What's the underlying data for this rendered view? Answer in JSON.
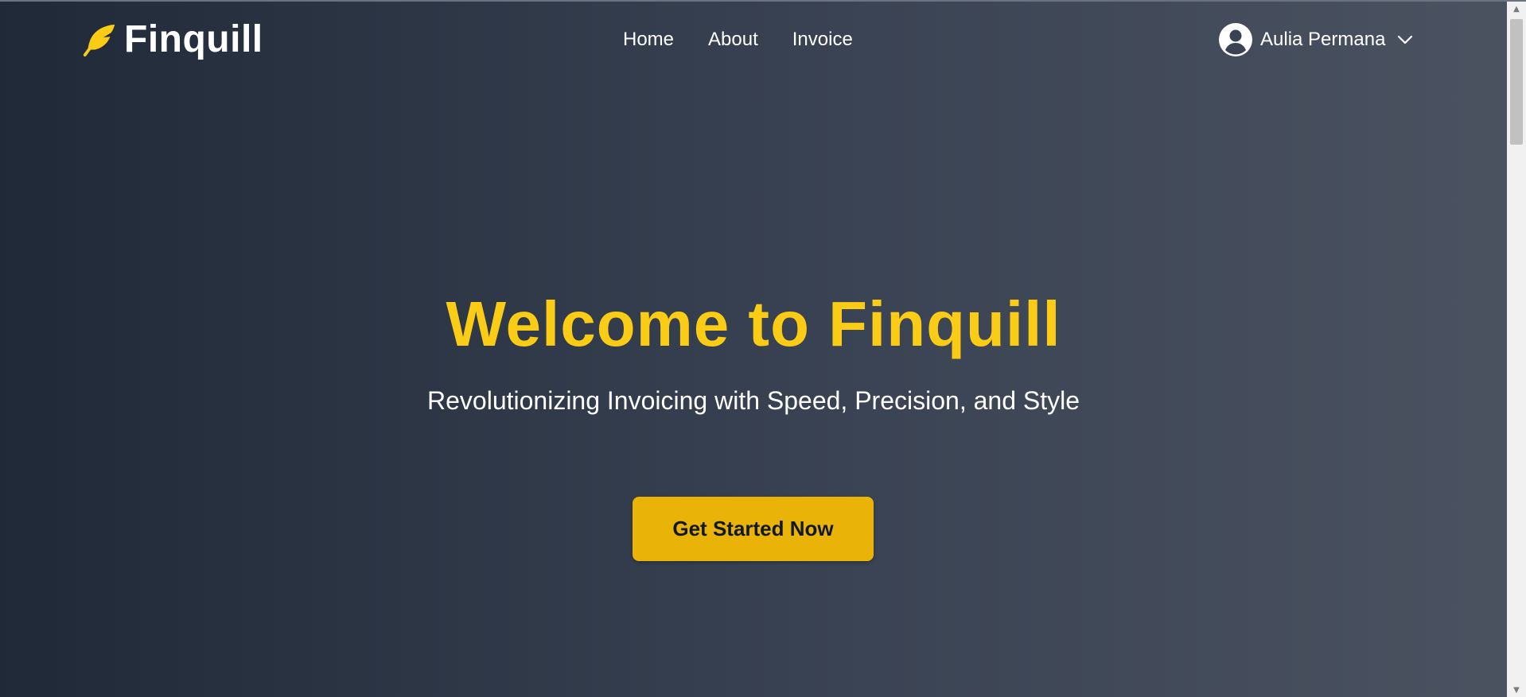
{
  "nav": {
    "brand": "Finquill",
    "links": [
      "Home",
      "About",
      "Invoice"
    ],
    "user_name": "Aulia Permana"
  },
  "hero": {
    "title": "Welcome to Finquill",
    "subtitle": "Revolutionizing Invoicing with Speed, Precision, and Style",
    "cta_label": "Get Started Now"
  },
  "icons": {
    "brand": "feather-icon",
    "user": "user-circle-icon",
    "dropdown": "chevron-down-icon"
  },
  "colors": {
    "accent": "#facc15",
    "button": "#eab308",
    "background_start": "#1f2937",
    "background_end": "#4b5361"
  }
}
